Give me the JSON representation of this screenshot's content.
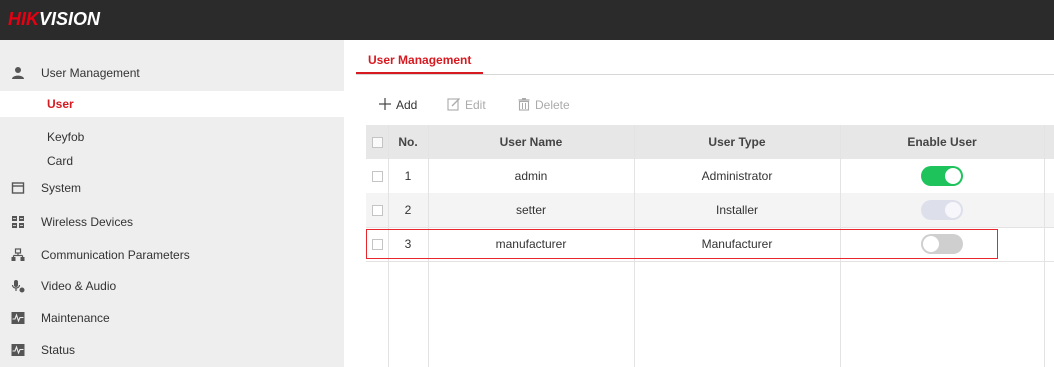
{
  "brand": {
    "logo_red": "HIK",
    "logo_white": "VISION",
    "accent": "#d71920",
    "topbar_bg": "#2b2b2b"
  },
  "sidebar": {
    "groups": [
      {
        "label": "User Management",
        "icon": "user-icon"
      },
      {
        "label": "System",
        "icon": "system-icon"
      },
      {
        "label": "Wireless Devices",
        "icon": "wireless-devices-icon"
      },
      {
        "label": "Communication Parameters",
        "icon": "network-icon"
      },
      {
        "label": "Video & Audio",
        "icon": "video-audio-icon"
      },
      {
        "label": "Maintenance",
        "icon": "maintenance-icon"
      },
      {
        "label": "Status",
        "icon": "status-icon"
      }
    ],
    "subitems": [
      {
        "label": "User",
        "active": true
      },
      {
        "label": "Keyfob",
        "active": false
      },
      {
        "label": "Card",
        "active": false
      }
    ]
  },
  "tabs": [
    {
      "label": "User Management",
      "active": true
    }
  ],
  "toolbar": {
    "add_label": "Add",
    "edit_label": "Edit",
    "delete_label": "Delete"
  },
  "table": {
    "headers": {
      "no": "No.",
      "user_name": "User Name",
      "user_type": "User Type",
      "enable_user": "Enable User"
    },
    "rows": [
      {
        "no": "1",
        "user_name": "admin",
        "user_type": "Administrator",
        "enabled": "on"
      },
      {
        "no": "2",
        "user_name": "setter",
        "user_type": "Installer",
        "enabled": "on-disabled"
      },
      {
        "no": "3",
        "user_name": "manufacturer",
        "user_type": "Manufacturer",
        "enabled": "off"
      }
    ],
    "toggle_colors": {
      "on": "#1ec35b",
      "disabled": "#dde0ea",
      "off": "#cfcfcf"
    },
    "highlight_color": "#e8262b"
  }
}
